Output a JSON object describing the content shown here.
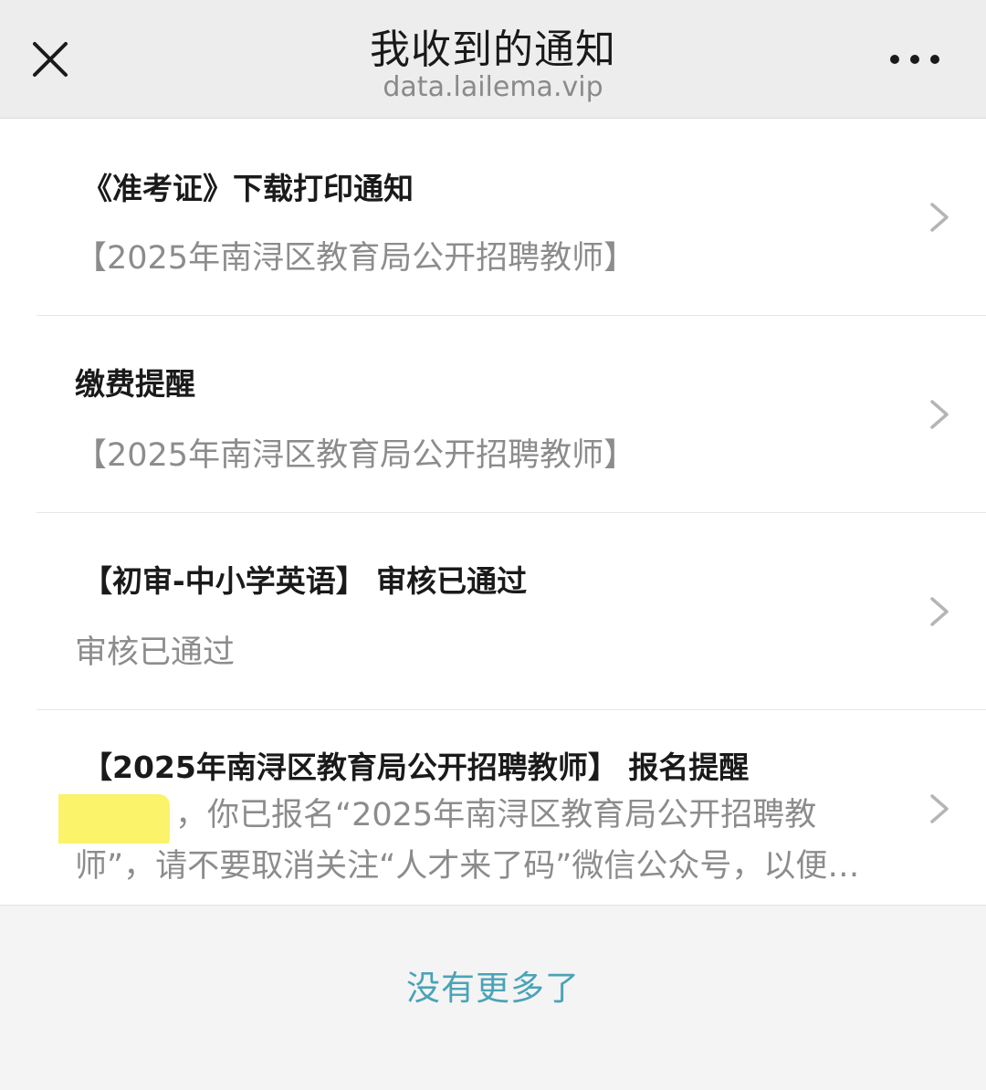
{
  "header": {
    "title": "我收到的通知",
    "subtitle": "data.lailema.vip",
    "close_icon": "close-icon",
    "more_icon": "more-dots-icon"
  },
  "notifications": [
    {
      "title": "《准考证》下载打印通知",
      "desc": "【2025年南浔区教育局公开招聘教师】"
    },
    {
      "title": "缴费提醒",
      "desc": "【2025年南浔区教育局公开招聘教师】"
    },
    {
      "title": "【初审-中小学英语】 审核已通过",
      "desc": "审核已通过"
    },
    {
      "title": "【2025年南浔区教育局公开招聘教师】 报名提醒",
      "desc_line1": "，你已报名“2025年南浔区教育局公开招聘教",
      "desc_line2": "师”，请不要取消关注“人才来了码”微信公众号，以便…"
    }
  ],
  "footer": {
    "text": "没有更多了"
  },
  "colors": {
    "accent": "#4aa3b8",
    "highlight": "#fbf36a"
  }
}
